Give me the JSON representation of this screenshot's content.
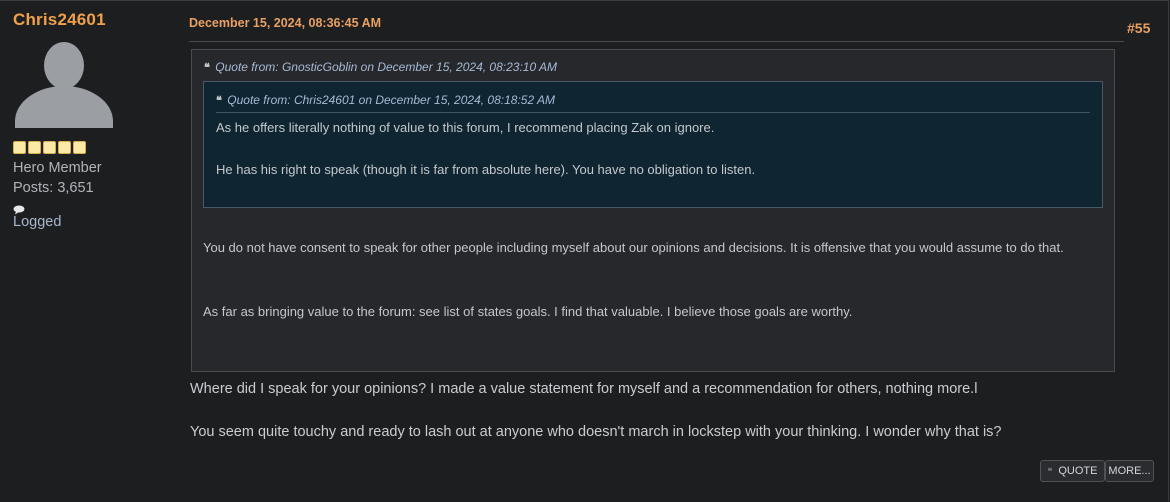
{
  "poster": {
    "username": "Chris24601",
    "rank_stars": 5,
    "member_group": "Hero Member",
    "posts": "Posts: 3,651",
    "logged": "Logged"
  },
  "post": {
    "date": "December 15, 2024, 08:36:45 AM",
    "number": "#55"
  },
  "outer_quote": {
    "header": "Quote from: GnosticGoblin on December 15, 2024, 08:23:10 AM",
    "inner_quote": {
      "header": "Quote from: Chris24601 on December 15, 2024, 08:18:52 AM",
      "paragraphs": [
        "As he offers literally nothing of value to this forum, I recommend placing Zak on ignore.",
        "He has his right to speak (though it is far from absolute here). You have no obligation to listen."
      ]
    },
    "paragraphs": [
      "You do not have consent to speak for other people including myself about our opinions and decisions. It is offensive that you would assume to do that.",
      "As far as bringing value to the forum: see list of states goals. I find that valuable. I believe those goals are worthy."
    ]
  },
  "reply": [
    "Where did I speak for your opinions? I made a value statement for myself and a recommendation for others, nothing more.l",
    "You seem quite touchy and ready to lash out at anyone who doesn't march in lockstep with your thinking. I wonder why that is?"
  ],
  "buttons": {
    "quote": "QUOTE",
    "more": "MORE..."
  },
  "colors": {
    "accent": "#f0a04b",
    "quote_link": "#a7bad6",
    "inner_quote_bg": "#0f2532"
  }
}
